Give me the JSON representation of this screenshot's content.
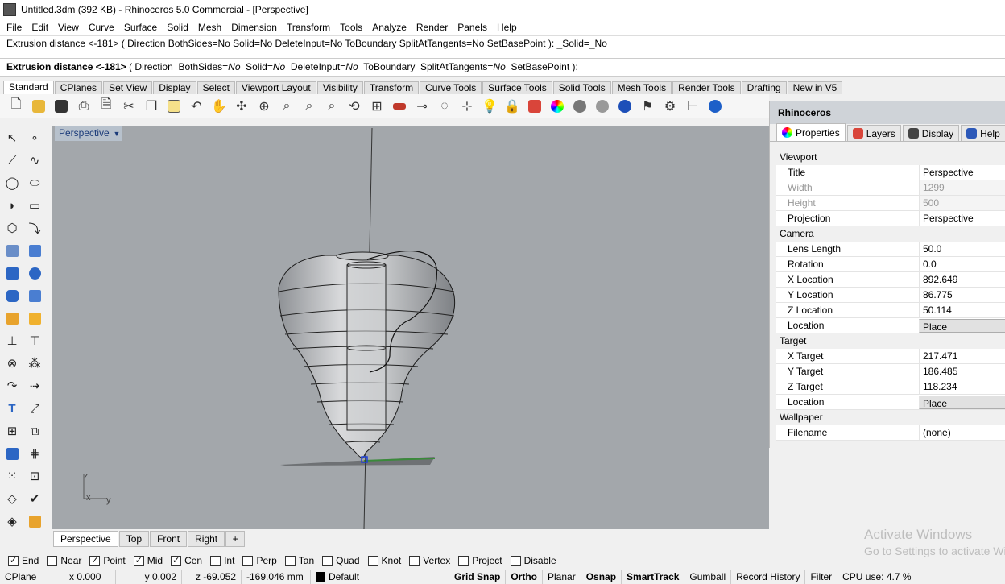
{
  "window": {
    "title": "Untitled.3dm (392 KB) - Rhinoceros 5.0 Commercial - [Perspective]"
  },
  "menu": [
    "File",
    "Edit",
    "View",
    "Curve",
    "Surface",
    "Solid",
    "Mesh",
    "Dimension",
    "Transform",
    "Tools",
    "Analyze",
    "Render",
    "Panels",
    "Help"
  ],
  "command": {
    "history": "Extrusion distance <-181> ( Direction  BothSides=No  Solid=No  DeleteInput=No  ToBoundary  SplitAtTangents=No  SetBasePoint ): _Solid=_No",
    "prompt_label": "Extrusion distance <-181>",
    "prompt_open": " ( ",
    "opt_direction": "Direction",
    "opt_bothsides": "BothSides=",
    "opt_solid": "Solid=",
    "opt_deleteinput": "DeleteInput=",
    "opt_toboundary": "ToBoundary",
    "opt_split": "SplitAtTangents=",
    "opt_setbase": "SetBasePoint",
    "no": "No",
    "prompt_close": " ):"
  },
  "toolbar_tabs": [
    "Standard",
    "CPlanes",
    "Set View",
    "Display",
    "Select",
    "Viewport Layout",
    "Visibility",
    "Transform",
    "Curve Tools",
    "Surface Tools",
    "Solid Tools",
    "Mesh Tools",
    "Render Tools",
    "Drafting",
    "New in V5"
  ],
  "viewport": {
    "title": "Perspective",
    "dropdown_glyph": "▼",
    "axis_z": "z",
    "axis_x": "x",
    "axis_y": "y"
  },
  "viewport_tabs": [
    "Perspective",
    "Top",
    "Front",
    "Right"
  ],
  "viewport_add": "+",
  "osnaps": [
    {
      "label": "End",
      "checked": true
    },
    {
      "label": "Near",
      "checked": false
    },
    {
      "label": "Point",
      "checked": true
    },
    {
      "label": "Mid",
      "checked": true
    },
    {
      "label": "Cen",
      "checked": true
    },
    {
      "label": "Int",
      "checked": false
    },
    {
      "label": "Perp",
      "checked": false
    },
    {
      "label": "Tan",
      "checked": false
    },
    {
      "label": "Quad",
      "checked": false
    },
    {
      "label": "Knot",
      "checked": false
    },
    {
      "label": "Vertex",
      "checked": false
    },
    {
      "label": "Project",
      "checked": false
    },
    {
      "label": "Disable",
      "checked": false
    }
  ],
  "status": {
    "cplane": "CPlane",
    "x": "x 0.000",
    "y": "y 0.002",
    "z": "z -69.052",
    "distance": "-169.046 mm",
    "layer": "Default",
    "grid_snap": "Grid Snap",
    "ortho": "Ortho",
    "planar": "Planar",
    "osnap": "Osnap",
    "smarttrack": "SmartTrack",
    "gumball": "Gumball",
    "record_history": "Record History",
    "filter": "Filter",
    "cpu": "CPU use: 4.7 %"
  },
  "panel": {
    "title": "Rhinoceros",
    "tabs": [
      "Properties",
      "Layers",
      "Display",
      "Help"
    ],
    "sections": {
      "viewport": "Viewport",
      "camera": "Camera",
      "target": "Target",
      "wallpaper": "Wallpaper"
    },
    "viewport_rows": [
      {
        "k": "Title",
        "v": "Perspective"
      },
      {
        "k": "Width",
        "v": "1299"
      },
      {
        "k": "Height",
        "v": "500"
      },
      {
        "k": "Projection",
        "v": "Perspective"
      }
    ],
    "camera_rows": [
      {
        "k": "Lens Length",
        "v": "50.0"
      },
      {
        "k": "Rotation",
        "v": "0.0"
      },
      {
        "k": "X Location",
        "v": "892.649"
      },
      {
        "k": "Y Location",
        "v": "86.775"
      },
      {
        "k": "Z Location",
        "v": "50.114"
      },
      {
        "k": "Location",
        "v": "Place"
      }
    ],
    "target_rows": [
      {
        "k": "X Target",
        "v": "217.471"
      },
      {
        "k": "Y Target",
        "v": "186.485"
      },
      {
        "k": "Z Target",
        "v": "118.234"
      },
      {
        "k": "Location",
        "v": "Place"
      }
    ],
    "wallpaper_rows": [
      {
        "k": "Filename",
        "v": "(none)"
      }
    ]
  },
  "watermark": {
    "line1": "Activate Windows",
    "line2": "Go to Settings to activate Windows."
  },
  "colors": {
    "viewport_bg": "#a3a7ab",
    "viewport_title_bg": "#b7c1cc",
    "panel_title_bg": "#cfd3d8"
  }
}
